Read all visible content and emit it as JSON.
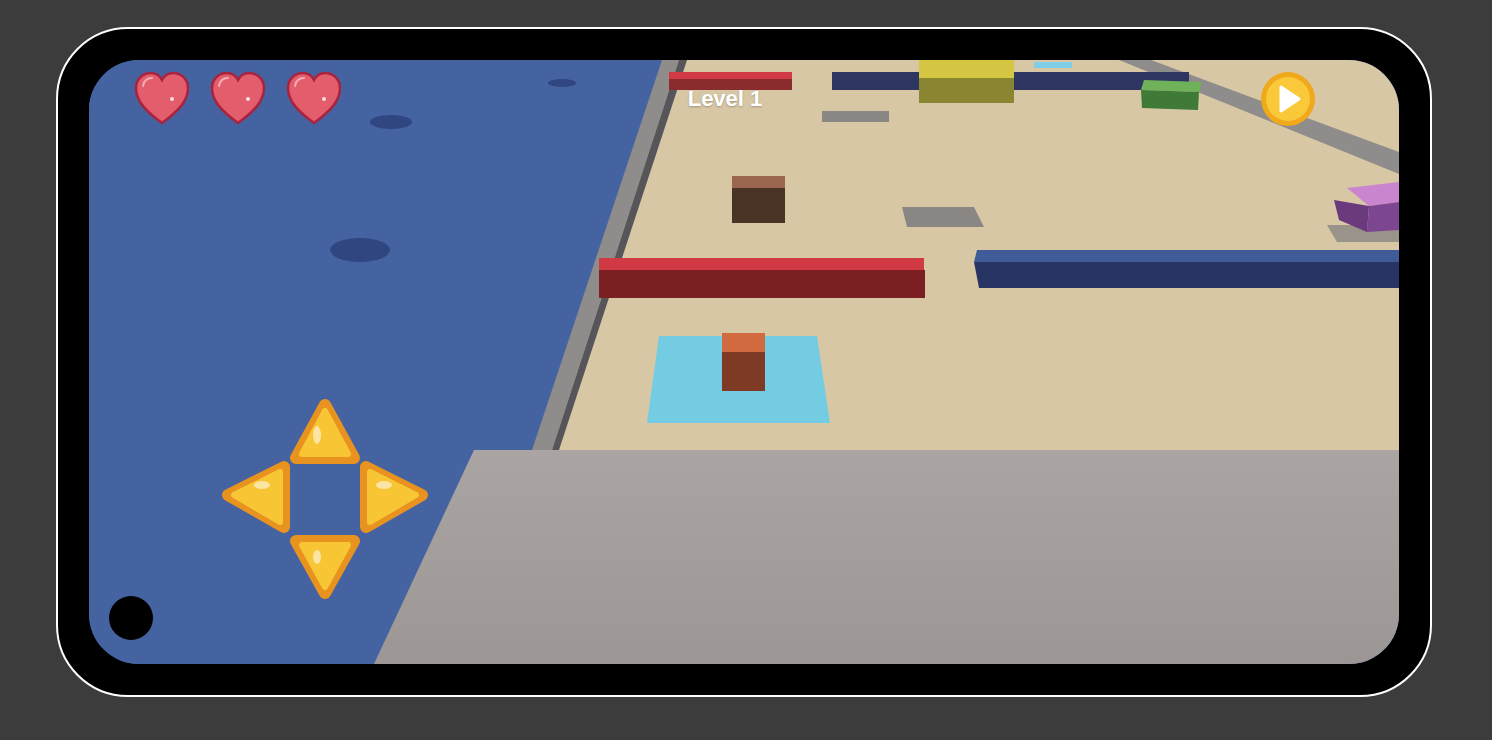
{
  "hud": {
    "level": "Level 1",
    "lives": [
      {
        "filled": true
      },
      {
        "filled": true
      },
      {
        "filled": true
      }
    ]
  }
}
